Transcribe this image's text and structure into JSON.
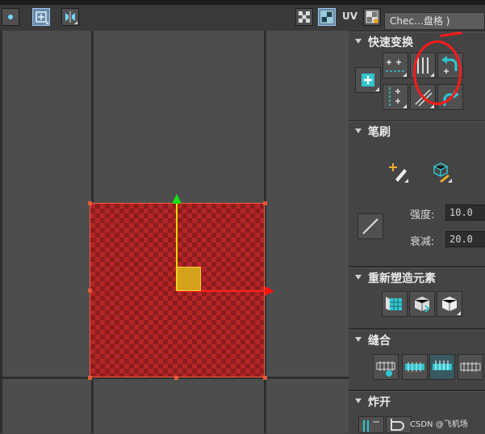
{
  "toolbar": {
    "uv_label": "UV",
    "checker_dropdown": "Chec…盘格 )"
  },
  "sections": {
    "quick_transform": {
      "title": "快速变换"
    },
    "brush": {
      "title": "笔刷",
      "strength_label": "强度:",
      "strength_value": "10.0",
      "falloff_label": "衰减:",
      "falloff_value": "20.0"
    },
    "reshape": {
      "title": "重新塑造元素"
    },
    "stitch": {
      "title": "缝合"
    },
    "explode": {
      "title": "炸开"
    }
  },
  "watermark": "CSDN @飞机场",
  "colors": {
    "accent": "#2fc6d0",
    "annotation": "#ff1a1a",
    "uv_checker": "#b42626"
  }
}
